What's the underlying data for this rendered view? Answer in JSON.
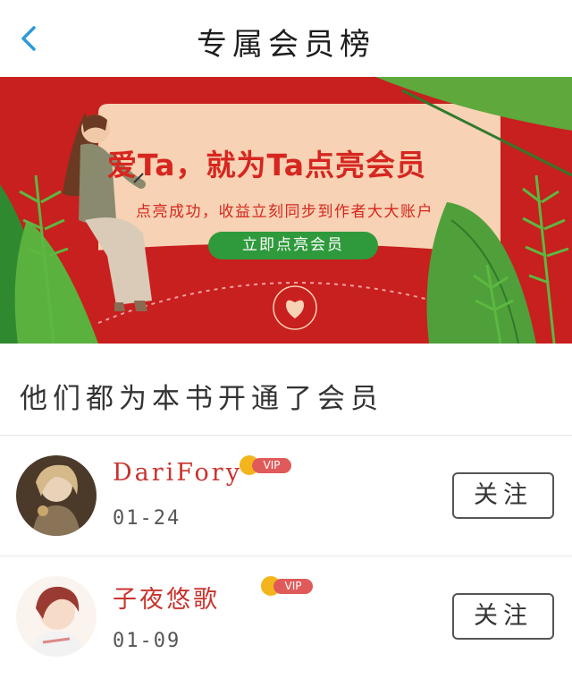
{
  "header": {
    "title": "专属会员榜",
    "back_icon": "chevron-left-icon"
  },
  "banner": {
    "headline": "爱Ta，就为Ta点亮会员",
    "subline": "点亮成功，收益立刻同步到作者大大账户",
    "cta_label": "立即点亮会员",
    "colors": {
      "background": "#c81f1f",
      "card": "#f7d2b4",
      "accent": "#d6261f",
      "button": "#2f9a3c"
    }
  },
  "section": {
    "title": "他们都为本书开通了会员"
  },
  "members": [
    {
      "name": "DariFory",
      "badge": "VIP",
      "date": "01-24",
      "follow_label": "关注"
    },
    {
      "name": "子夜悠歌",
      "badge": "VIP",
      "date": "01-09",
      "follow_label": "关注"
    }
  ]
}
